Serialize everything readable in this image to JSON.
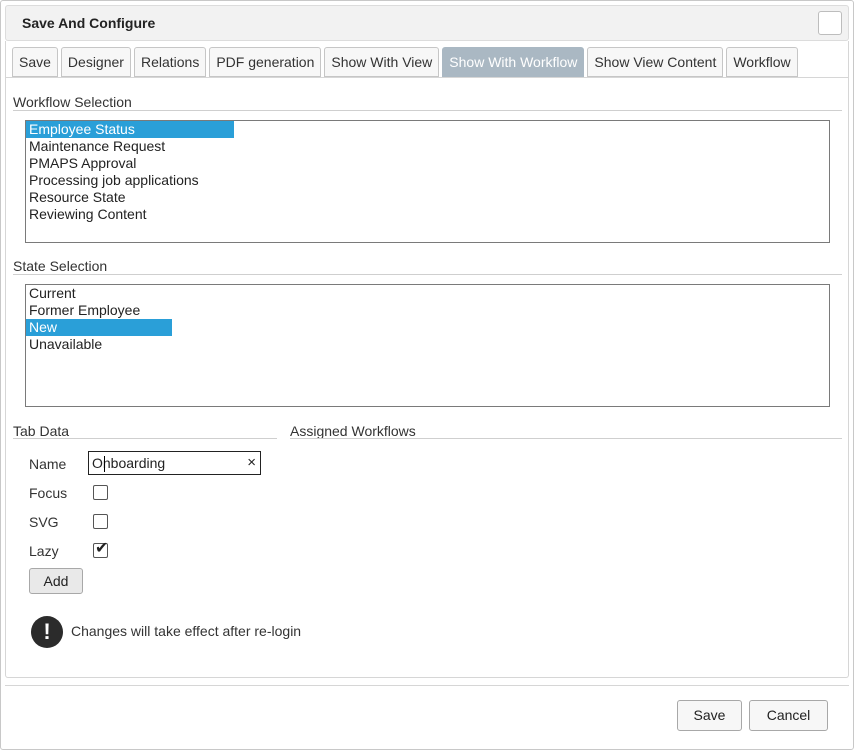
{
  "dialog": {
    "title": "Save And Configure"
  },
  "tabs": [
    {
      "label": "Save",
      "active": false
    },
    {
      "label": "Designer",
      "active": false
    },
    {
      "label": "Relations",
      "active": false
    },
    {
      "label": "PDF generation",
      "active": false
    },
    {
      "label": "Show With View",
      "active": false
    },
    {
      "label": "Show With Workflow",
      "active": true
    },
    {
      "label": "Show View Content",
      "active": false
    },
    {
      "label": "Workflow",
      "active": false
    }
  ],
  "workflow_selection": {
    "label": "Workflow Selection",
    "selected_index": 0,
    "items": [
      "Employee Status",
      "Maintenance Request",
      "PMAPS Approval",
      "Processing job applications",
      "Resource State",
      "Reviewing Content"
    ]
  },
  "state_selection": {
    "label": "State Selection",
    "selected_index": 2,
    "items": [
      "Current",
      "Former Employee",
      "New",
      "Unavailable"
    ]
  },
  "tab_data": {
    "label": "Tab Data",
    "name_label": "Name",
    "name_value": "Onboarding",
    "clear_glyph": "×",
    "focus_label": "Focus",
    "focus_checked": false,
    "svg_label": "SVG",
    "svg_checked": false,
    "lazy_label": "Lazy",
    "lazy_checked": true,
    "add_label": "Add"
  },
  "assigned_workflows": {
    "label": "Assigned Workflows"
  },
  "notice": {
    "icon": "exclamation-icon",
    "glyph": "!",
    "text": "Changes will take effect after re-login"
  },
  "footer": {
    "save_label": "Save",
    "cancel_label": "Cancel"
  },
  "colors": {
    "selection": "#2a9fd8",
    "active_tab": "#aab8c3"
  }
}
